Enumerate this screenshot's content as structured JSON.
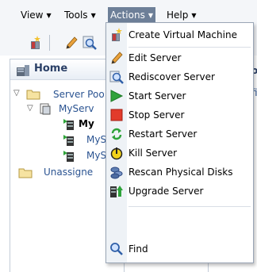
{
  "menubar": {
    "items": [
      {
        "label": "View",
        "mnemonic_index": 0
      },
      {
        "label": "Tools",
        "mnemonic_index": 0
      },
      {
        "label": "Actions",
        "mnemonic_index": 0,
        "active": true
      },
      {
        "label": "Help",
        "mnemonic_index": 0
      }
    ]
  },
  "toolbar": {
    "icons": [
      "create-vm-icon",
      "edit-pencil-icon",
      "search-magnifier-icon"
    ]
  },
  "tree": {
    "home_label": "Home",
    "rows": [
      {
        "label": "Server Poo",
        "level": 1,
        "expanded": true
      },
      {
        "label": "MyServ",
        "level": 2,
        "expanded": true
      },
      {
        "label": "My",
        "level": 3,
        "selected": true
      },
      {
        "label": "MyS",
        "level": 3
      },
      {
        "label": "MyS",
        "level": 3
      },
      {
        "label": "Unassigne",
        "level": 1
      }
    ],
    "right_fragment": [
      "o",
      "fi"
    ]
  },
  "actions_menu": {
    "items": [
      {
        "label": "Create Virtual Machine",
        "icon": "create-vm-icon",
        "mnemonic": "V"
      },
      {
        "label": "Edit Server",
        "icon": "pencil-icon",
        "mnemonic": "E"
      },
      {
        "label": "Rediscover Server",
        "icon": "rediscover-icon",
        "mnemonic": "d"
      },
      {
        "label": "Start Server",
        "icon": "start-play-icon",
        "mnemonic": "S"
      },
      {
        "label": "Stop Server",
        "icon": "stop-square-icon",
        "mnemonic": "t"
      },
      {
        "label": "Restart Server",
        "icon": "restart-icon",
        "mnemonic": "R"
      },
      {
        "label": "Kill Server",
        "icon": "kill-power-icon",
        "mnemonic": "K"
      },
      {
        "label": "Rescan Physical Disks",
        "icon": "disks-icon",
        "mnemonic": "n"
      },
      {
        "label": "Upgrade Server",
        "icon": "upgrade-icon",
        "mnemonic": "U"
      },
      {
        "label": "Find",
        "icon": "find-icon",
        "mnemonic": "F"
      }
    ]
  },
  "colors": {
    "menu_active_bg": "#6d7f98",
    "link_blue": "#2a5391",
    "play_green": "#2fa33a",
    "stop_red": "#e23b2b"
  }
}
